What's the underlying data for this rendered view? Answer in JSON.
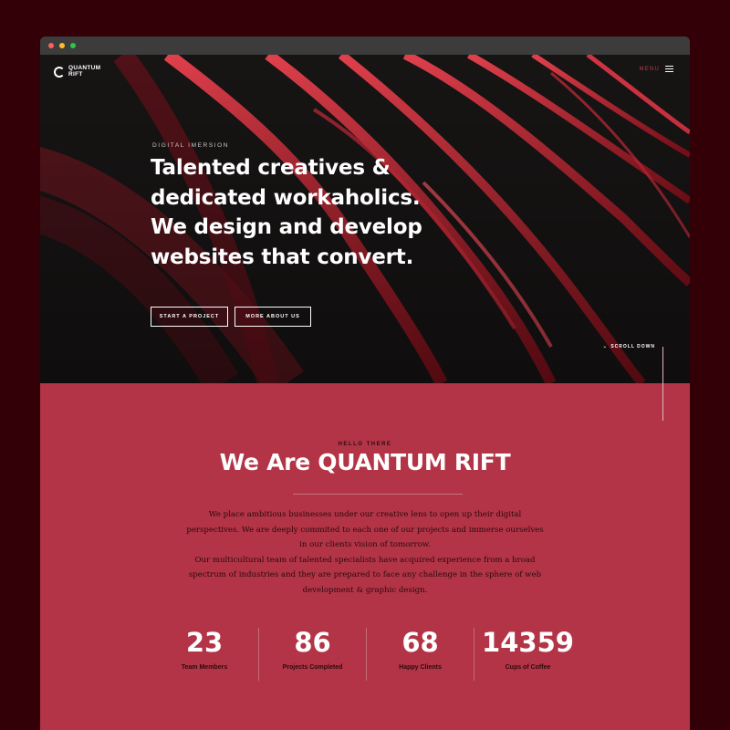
{
  "brand": {
    "line1": "QUANTUM",
    "line2": "RIFT"
  },
  "nav": {
    "menu_label": "MENU"
  },
  "hero": {
    "eyebrow": "DIGITAL IMERSION",
    "headline": [
      "Talented creatives &",
      "dedicated workaholics.",
      "We design and develop",
      "websites that convert."
    ],
    "start_button": "START A PROJECT",
    "more_button": "MORE ABOUT US",
    "scroll_label": "SCROLL DOWN"
  },
  "about": {
    "eyebrow": "HELLO THERE",
    "title": "We Are QUANTUM RIFT",
    "paragraphs": [
      "We place ambitious businesses under our creative lens to open up their digital perspectives. We are deeply commited to each one of our projects and immerse ourselves in our clients vision of tomorrow.",
      "Our multicultural team of talented specialists have acquired experience from a broad spectrum of industries and they are prepared to face any challenge in the sphere of web development & graphic design."
    ]
  },
  "stats": [
    {
      "value": "23",
      "label": "Team Members"
    },
    {
      "value": "86",
      "label": "Projects Completed"
    },
    {
      "value": "68",
      "label": "Happy Clients"
    },
    {
      "value": "14359",
      "label": "Cups of Coffee"
    }
  ],
  "colors": {
    "background": "#330008",
    "accent": "#b23446",
    "hero_dark": "#161313",
    "ribbon": "#c7222f"
  },
  "icons": {
    "menu": "hamburger-icon",
    "scroll": "chevron-down-icon",
    "logo": "ring-logo-icon"
  }
}
